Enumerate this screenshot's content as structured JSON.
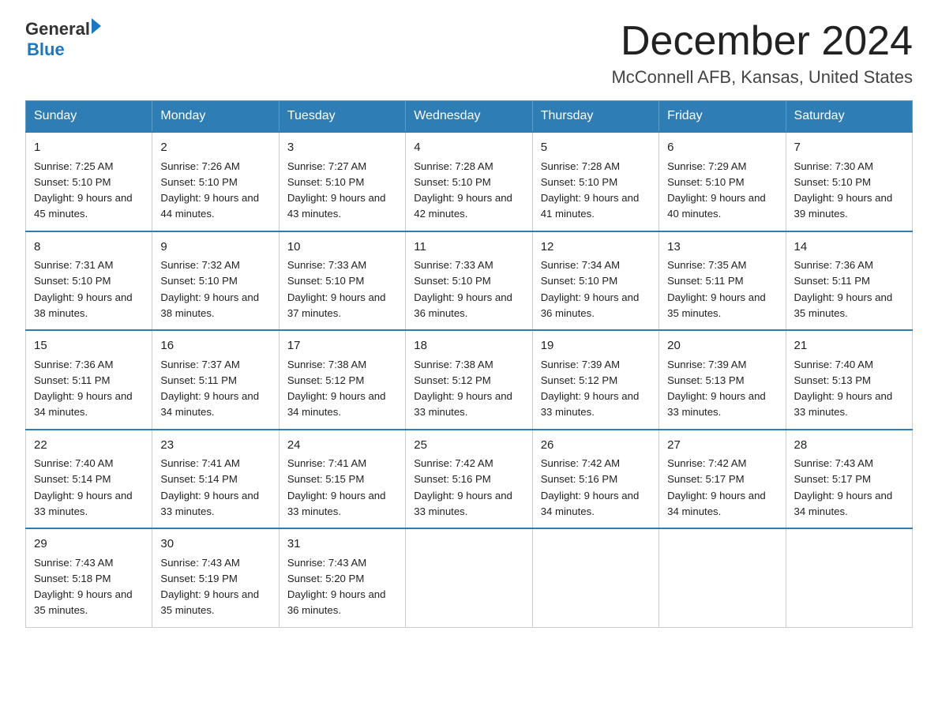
{
  "logo": {
    "general": "General",
    "arrow": "▶",
    "blue": "Blue"
  },
  "title": "December 2024",
  "subtitle": "McConnell AFB, Kansas, United States",
  "days_of_week": [
    "Sunday",
    "Monday",
    "Tuesday",
    "Wednesday",
    "Thursday",
    "Friday",
    "Saturday"
  ],
  "weeks": [
    [
      {
        "day": "1",
        "sunrise": "7:25 AM",
        "sunset": "5:10 PM",
        "daylight": "9 hours and 45 minutes."
      },
      {
        "day": "2",
        "sunrise": "7:26 AM",
        "sunset": "5:10 PM",
        "daylight": "9 hours and 44 minutes."
      },
      {
        "day": "3",
        "sunrise": "7:27 AM",
        "sunset": "5:10 PM",
        "daylight": "9 hours and 43 minutes."
      },
      {
        "day": "4",
        "sunrise": "7:28 AM",
        "sunset": "5:10 PM",
        "daylight": "9 hours and 42 minutes."
      },
      {
        "day": "5",
        "sunrise": "7:28 AM",
        "sunset": "5:10 PM",
        "daylight": "9 hours and 41 minutes."
      },
      {
        "day": "6",
        "sunrise": "7:29 AM",
        "sunset": "5:10 PM",
        "daylight": "9 hours and 40 minutes."
      },
      {
        "day": "7",
        "sunrise": "7:30 AM",
        "sunset": "5:10 PM",
        "daylight": "9 hours and 39 minutes."
      }
    ],
    [
      {
        "day": "8",
        "sunrise": "7:31 AM",
        "sunset": "5:10 PM",
        "daylight": "9 hours and 38 minutes."
      },
      {
        "day": "9",
        "sunrise": "7:32 AM",
        "sunset": "5:10 PM",
        "daylight": "9 hours and 38 minutes."
      },
      {
        "day": "10",
        "sunrise": "7:33 AM",
        "sunset": "5:10 PM",
        "daylight": "9 hours and 37 minutes."
      },
      {
        "day": "11",
        "sunrise": "7:33 AM",
        "sunset": "5:10 PM",
        "daylight": "9 hours and 36 minutes."
      },
      {
        "day": "12",
        "sunrise": "7:34 AM",
        "sunset": "5:10 PM",
        "daylight": "9 hours and 36 minutes."
      },
      {
        "day": "13",
        "sunrise": "7:35 AM",
        "sunset": "5:11 PM",
        "daylight": "9 hours and 35 minutes."
      },
      {
        "day": "14",
        "sunrise": "7:36 AM",
        "sunset": "5:11 PM",
        "daylight": "9 hours and 35 minutes."
      }
    ],
    [
      {
        "day": "15",
        "sunrise": "7:36 AM",
        "sunset": "5:11 PM",
        "daylight": "9 hours and 34 minutes."
      },
      {
        "day": "16",
        "sunrise": "7:37 AM",
        "sunset": "5:11 PM",
        "daylight": "9 hours and 34 minutes."
      },
      {
        "day": "17",
        "sunrise": "7:38 AM",
        "sunset": "5:12 PM",
        "daylight": "9 hours and 34 minutes."
      },
      {
        "day": "18",
        "sunrise": "7:38 AM",
        "sunset": "5:12 PM",
        "daylight": "9 hours and 33 minutes."
      },
      {
        "day": "19",
        "sunrise": "7:39 AM",
        "sunset": "5:12 PM",
        "daylight": "9 hours and 33 minutes."
      },
      {
        "day": "20",
        "sunrise": "7:39 AM",
        "sunset": "5:13 PM",
        "daylight": "9 hours and 33 minutes."
      },
      {
        "day": "21",
        "sunrise": "7:40 AM",
        "sunset": "5:13 PM",
        "daylight": "9 hours and 33 minutes."
      }
    ],
    [
      {
        "day": "22",
        "sunrise": "7:40 AM",
        "sunset": "5:14 PM",
        "daylight": "9 hours and 33 minutes."
      },
      {
        "day": "23",
        "sunrise": "7:41 AM",
        "sunset": "5:14 PM",
        "daylight": "9 hours and 33 minutes."
      },
      {
        "day": "24",
        "sunrise": "7:41 AM",
        "sunset": "5:15 PM",
        "daylight": "9 hours and 33 minutes."
      },
      {
        "day": "25",
        "sunrise": "7:42 AM",
        "sunset": "5:16 PM",
        "daylight": "9 hours and 33 minutes."
      },
      {
        "day": "26",
        "sunrise": "7:42 AM",
        "sunset": "5:16 PM",
        "daylight": "9 hours and 34 minutes."
      },
      {
        "day": "27",
        "sunrise": "7:42 AM",
        "sunset": "5:17 PM",
        "daylight": "9 hours and 34 minutes."
      },
      {
        "day": "28",
        "sunrise": "7:43 AM",
        "sunset": "5:17 PM",
        "daylight": "9 hours and 34 minutes."
      }
    ],
    [
      {
        "day": "29",
        "sunrise": "7:43 AM",
        "sunset": "5:18 PM",
        "daylight": "9 hours and 35 minutes."
      },
      {
        "day": "30",
        "sunrise": "7:43 AM",
        "sunset": "5:19 PM",
        "daylight": "9 hours and 35 minutes."
      },
      {
        "day": "31",
        "sunrise": "7:43 AM",
        "sunset": "5:20 PM",
        "daylight": "9 hours and 36 minutes."
      },
      null,
      null,
      null,
      null
    ]
  ]
}
